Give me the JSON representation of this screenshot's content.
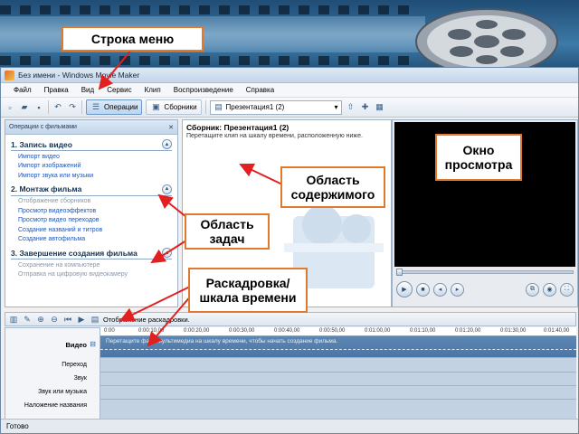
{
  "window": {
    "title": "Без имени - Windows Movie Maker",
    "menu": [
      "Файл",
      "Правка",
      "Вид",
      "Сервис",
      "Клип",
      "Воспроизведение",
      "Справка"
    ]
  },
  "toolbar": {
    "operations_label": "Операции",
    "collections_label": "Сборники",
    "collection_select": "Презентация1 (2)"
  },
  "tasks": {
    "header": "Операции с фильмами",
    "sections": [
      {
        "title": "1. Запись видео",
        "items": [
          "Импорт видео",
          "Импорт изображений",
          "Импорт звука или музыки"
        ],
        "dim": false
      },
      {
        "title": "2. Монтаж фильма",
        "items": [
          "Отображение сборников",
          "Просмотр видеоэффектов",
          "Просмотр видео переходов",
          "Создание названий и титров",
          "Создание автофильма"
        ],
        "dim_first": true
      },
      {
        "title": "3. Завершение создания фильма",
        "items": [
          "Сохранение на компьютере",
          "Отправка на цифровую видеокамеру"
        ],
        "dim": true
      }
    ]
  },
  "collection": {
    "title": "Сборник: Презентация1 (2)",
    "hint": "Перетащите клип на шкалу времени, расположенную ниже."
  },
  "timeline": {
    "toolbar_label": "Отображение раскадровки.",
    "ruler": [
      "0:00",
      "0:00:10,00",
      "0:00:20,00",
      "0:00:30,00",
      "0:00:40,00",
      "0:00:50,00",
      "0:01:00,00",
      "0:01:10,00",
      "0:01:20,00",
      "0:01:30,00",
      "0:01:40,00"
    ],
    "tracks": [
      "Видео",
      "Переход",
      "Звук",
      "Звук или музыка",
      "Наложение названия"
    ],
    "video_hint": "Перетащите файл мультимедиа на шкалу времени, чтобы начать создание фильма."
  },
  "status": "Готово",
  "callouts": {
    "menu": "Строка меню",
    "content": "Область содержимого",
    "tasks": "Область задач",
    "preview": "Окно просмотра",
    "storyboard": "Раскадровка/ шкала времени"
  },
  "colors": {
    "callout_border": "#e07a2e",
    "arrow": "#e32020",
    "link": "#1f56b5"
  }
}
